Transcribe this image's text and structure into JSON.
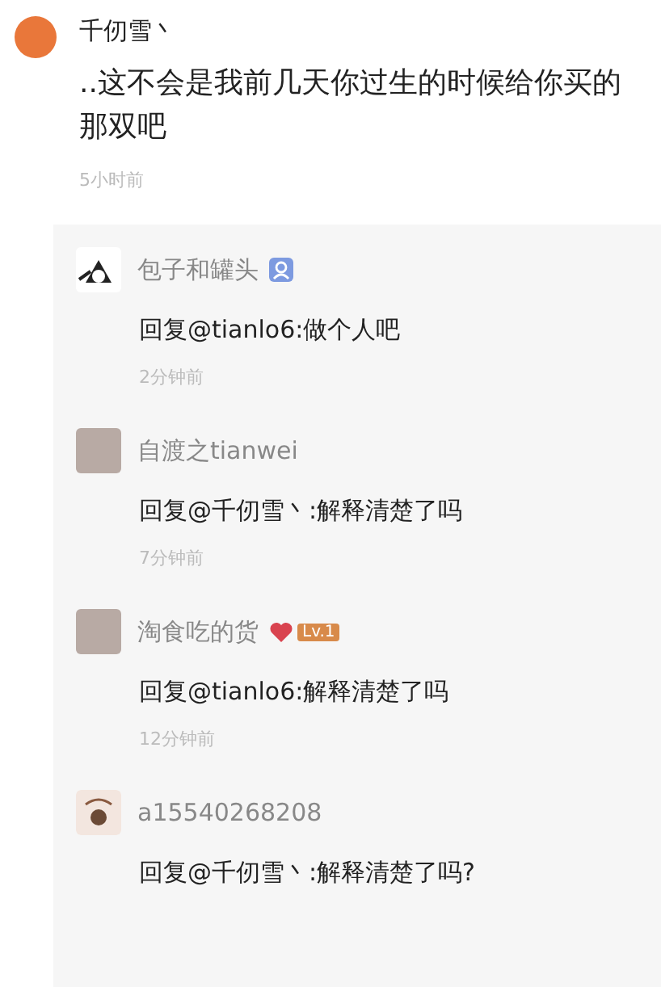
{
  "post": {
    "author": "千仞雪丶",
    "text": "..这不会是我前几天你过生的时候给你买的那双吧",
    "time": "5小时前"
  },
  "replies": [
    {
      "author": "包子和罐头",
      "avatar": {
        "kind": "drawing"
      },
      "badges": [
        {
          "kind": "verified"
        }
      ],
      "text": "回复@tianlo6:做个人吧",
      "time": "2分钟前"
    },
    {
      "author": "自渡之tianwei",
      "avatar": {
        "kind": "photo"
      },
      "text": "回复@千仞雪丶:解释清楚了吗",
      "time": "7分钟前"
    },
    {
      "author": "淘食吃的货",
      "avatar": {
        "kind": "photo"
      },
      "badges": [
        {
          "kind": "heart"
        },
        {
          "kind": "level",
          "label": "Lv.1"
        }
      ],
      "text": "回复@tianlo6:解释清楚了吗",
      "time": "12分钟前"
    },
    {
      "author": "a15540268208",
      "avatar": {
        "kind": "sticker"
      },
      "text": "回复@千仞雪丶:解释清楚了吗?"
    }
  ]
}
